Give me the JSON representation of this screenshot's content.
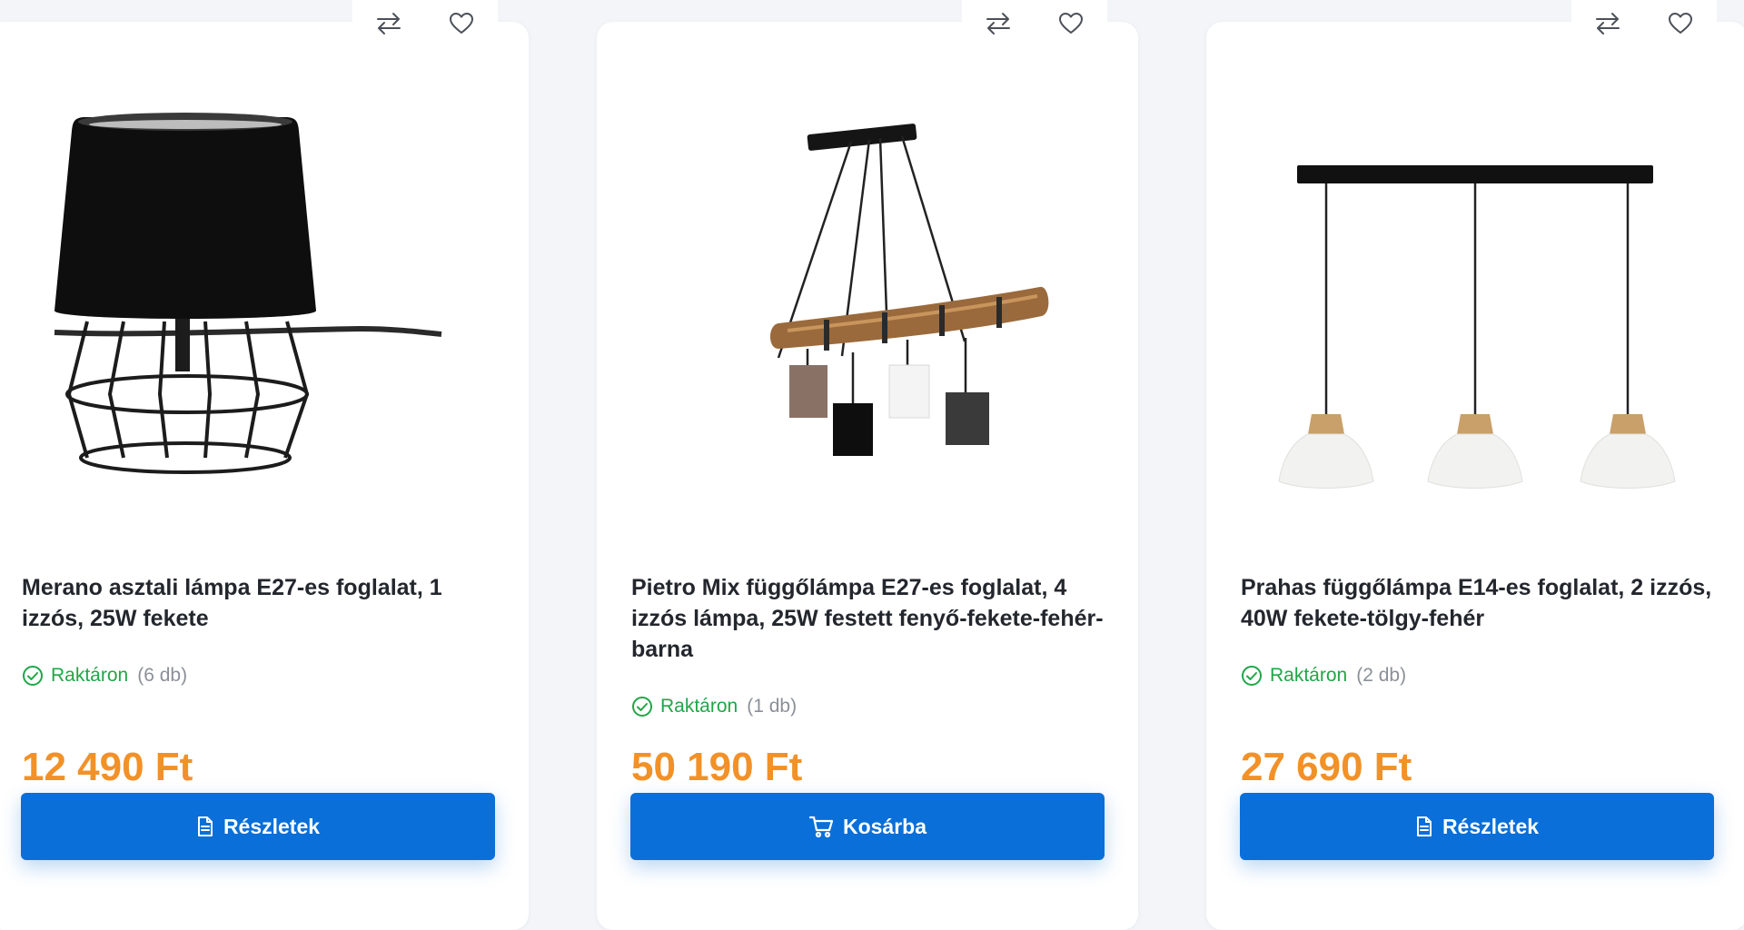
{
  "colors": {
    "accent": "#0a6fd8",
    "price": "#f29128",
    "in_stock": "#20a647",
    "title": "#23272d",
    "muted": "#8b9098"
  },
  "icons": {
    "compare": "arrows-exchange-icon",
    "wishlist": "heart-icon",
    "stock": "check-circle-icon",
    "details": "document-icon",
    "cart": "shopping-cart-icon"
  },
  "products": [
    {
      "title": "Merano asztali lámpa E27-es foglalat, 1 izzós, 25W fekete",
      "stock_label": "Raktáron",
      "stock_qty": "(6 db)",
      "price": "12 490 Ft",
      "button_label": "Részletek",
      "button_icon": "document-icon"
    },
    {
      "title": "Pietro Mix függőlámpa E27-es foglalat, 4 izzós lámpa, 25W festett fenyő-fekete-fehér-barna",
      "stock_label": "Raktáron",
      "stock_qty": "(1 db)",
      "price": "50 190 Ft",
      "button_label": "Kosárba",
      "button_icon": "shopping-cart-icon"
    },
    {
      "title": "Prahas függőlámpa E14-es foglalat, 2 izzós, 40W fekete-tölgy-fehér",
      "stock_label": "Raktáron",
      "stock_qty": "(2 db)",
      "price": "27 690 Ft",
      "button_label": "Részletek",
      "button_icon": "document-icon"
    }
  ]
}
